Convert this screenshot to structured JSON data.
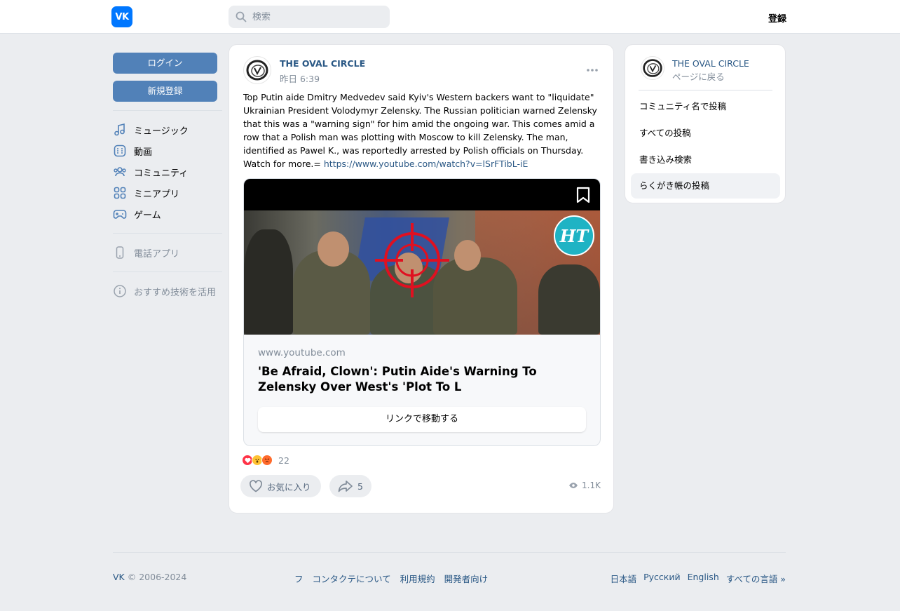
{
  "header": {
    "logo_text": "VK",
    "search_placeholder": "検索",
    "register_label": "登録"
  },
  "left_sidebar": {
    "login_label": "ログイン",
    "signup_label": "新規登録",
    "nav": [
      {
        "label": "ミュージック",
        "icon": "music-icon"
      },
      {
        "label": "動画",
        "icon": "video-icon"
      },
      {
        "label": "コミュニティ",
        "icon": "community-icon"
      },
      {
        "label": "ミニアプリ",
        "icon": "apps-icon"
      },
      {
        "label": "ゲーム",
        "icon": "gamepad-icon"
      }
    ],
    "phone_app_label": "電話アプリ",
    "recommend_label": "おすすめ技術を活用"
  },
  "post": {
    "author": "THE OVAL CIRCLE",
    "date": "昨日 6:39",
    "text": "Top Putin aide Dmitry Medvedev said Kyiv's Western backers want to \"liquidate\" Ukrainian President Volodymyr Zelensky. The Russian politician warned Zelensky that this was a \"warning sign\" for him amid the ongoing war. This comes amid a row that a Polish man was plotting with Moscow to kill Zelensky. The man, identified as Pawel K., was reportedly arrested by Polish officials on Thursday. Watch for more.=",
    "link": "https://www.youtube.com/watch?v=lSrFTibL-iE",
    "attachment": {
      "badge_text": "HT",
      "domain": "www.youtube.com",
      "title": "'Be Afraid, Clown': Putin Aide's Warning To Zelensky Over West's 'Plot To L",
      "button_label": "リンクで移動する"
    },
    "reactions_count": "22",
    "like_label": "お気に入り",
    "share_count": "5",
    "views": "1.1K"
  },
  "right_sidebar": {
    "name": "THE OVAL CIRCLE",
    "back_label": "ページに戻る",
    "items": [
      "コミュニティ名で投稿",
      "すべての投稿",
      "書き込み検索",
      "らくがき帳の投稿"
    ]
  },
  "footer": {
    "brand": "VK",
    "copyright": "© 2006-2024",
    "links": [
      "フ",
      "コンタクテについて",
      "利用規約",
      "開発者向け"
    ],
    "languages": [
      "日本語",
      "Русский",
      "English",
      "すべての言語 »"
    ]
  },
  "colors": {
    "accent": "#5181b8",
    "link": "#2a5885",
    "vk_blue": "#0077ff"
  }
}
